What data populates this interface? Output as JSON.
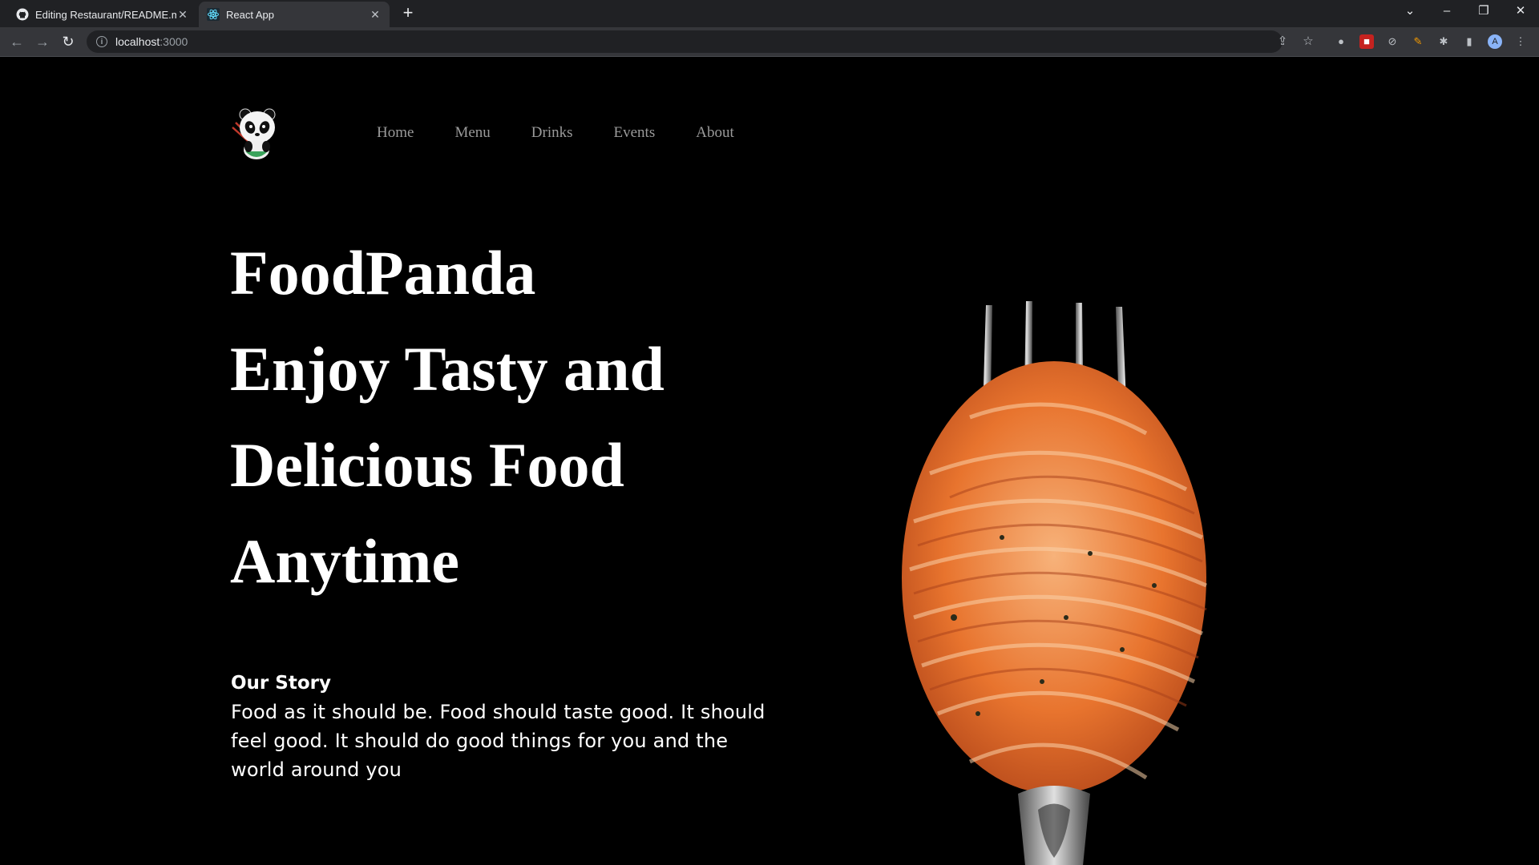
{
  "browser": {
    "tabs": [
      {
        "title": "Editing Restaurant/README.md",
        "icon": "github-icon",
        "active": false
      },
      {
        "title": "React App",
        "icon": "react-icon",
        "active": true
      }
    ],
    "address": {
      "host": "localhost",
      "port": ":3000"
    },
    "profile_initial": "A"
  },
  "nav": {
    "items": [
      "Home",
      "Menu",
      "Drinks",
      "Events",
      "About"
    ]
  },
  "hero": {
    "lines": [
      "FoodPanda",
      "Enjoy Tasty and",
      "Delicious Food",
      "Anytime"
    ]
  },
  "story": {
    "heading": "Our Story",
    "body": "Food as it should be. Food should taste good. It should feel good. It should do good things for you and the world around you"
  },
  "colors": {
    "background": "#000000",
    "chrome_dark": "#202124",
    "chrome_light": "#35363a",
    "nav_text": "#9a9a9a",
    "pasta": "#e8742e"
  }
}
